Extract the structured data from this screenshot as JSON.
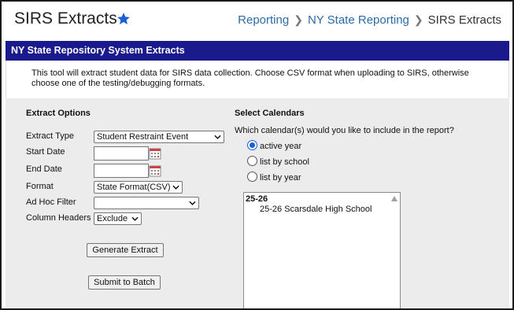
{
  "header": {
    "title": "SIRS Extracts",
    "breadcrumbs": [
      "Reporting",
      "NY State Reporting",
      "SIRS Extracts"
    ]
  },
  "banner": {
    "title": "NY State Repository System Extracts"
  },
  "description": "This tool will extract student data for SIRS data collection. Choose CSV format when uploading to SIRS, otherwise choose one of the testing/debugging formats.",
  "extract_options": {
    "title": "Extract Options",
    "extract_type": {
      "label": "Extract Type",
      "value": "Student Restraint Event"
    },
    "start_date": {
      "label": "Start Date",
      "value": ""
    },
    "end_date": {
      "label": "End Date",
      "value": ""
    },
    "format": {
      "label": "Format",
      "value": "State Format(CSV)"
    },
    "ad_hoc_filter": {
      "label": "Ad Hoc Filter",
      "value": ""
    },
    "column_headers": {
      "label": "Column Headers",
      "value": "Exclude"
    },
    "generate_button": "Generate Extract",
    "batch_button": "Submit to Batch"
  },
  "calendars": {
    "title": "Select Calendars",
    "question": "Which calendar(s) would you like to include in the report?",
    "options": [
      {
        "label": "active year",
        "selected": true
      },
      {
        "label": "list by school",
        "selected": false
      },
      {
        "label": "list by year",
        "selected": false
      }
    ],
    "list": {
      "group": "25-26",
      "items": [
        "25-26 Scarsdale High School"
      ]
    }
  },
  "colors": {
    "banner": "#1a1a8c",
    "link": "#2a6ca8",
    "star": "#1a5fd6",
    "panel": "#ececec"
  },
  "icons": [
    "star-icon",
    "chevron-right-icon",
    "calendar-icon",
    "dropdown-caret-icon",
    "scroll-up-icon"
  ]
}
